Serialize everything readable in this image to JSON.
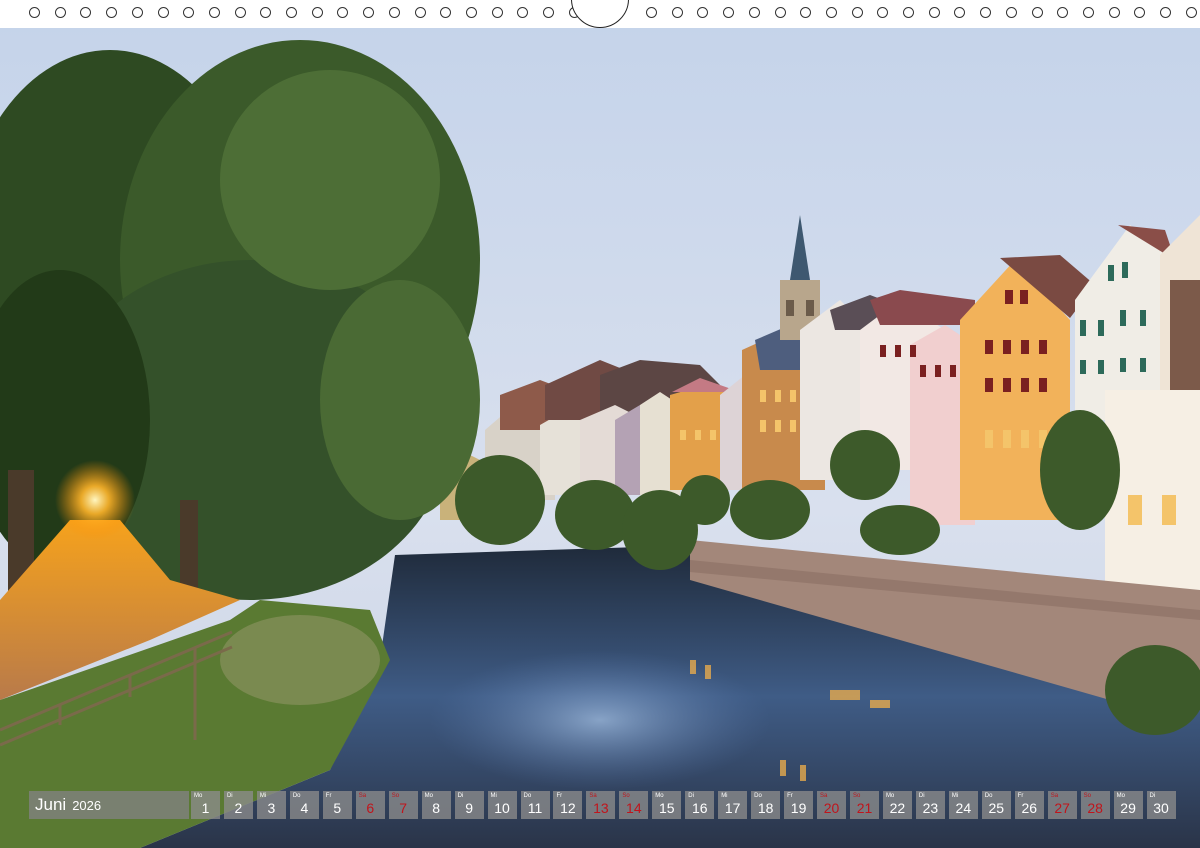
{
  "calendar": {
    "month": "Juni",
    "year": "2026",
    "days": [
      {
        "wd": "Mo",
        "d": "1",
        "we": false
      },
      {
        "wd": "Di",
        "d": "2",
        "we": false
      },
      {
        "wd": "Mi",
        "d": "3",
        "we": false
      },
      {
        "wd": "Do",
        "d": "4",
        "we": false
      },
      {
        "wd": "Fr",
        "d": "5",
        "we": false
      },
      {
        "wd": "Sa",
        "d": "6",
        "we": true
      },
      {
        "wd": "So",
        "d": "7",
        "we": true
      },
      {
        "wd": "Mo",
        "d": "8",
        "we": false
      },
      {
        "wd": "Di",
        "d": "9",
        "we": false
      },
      {
        "wd": "Mi",
        "d": "10",
        "we": false
      },
      {
        "wd": "Do",
        "d": "11",
        "we": false
      },
      {
        "wd": "Fr",
        "d": "12",
        "we": false
      },
      {
        "wd": "Sa",
        "d": "13",
        "we": true
      },
      {
        "wd": "So",
        "d": "14",
        "we": true
      },
      {
        "wd": "Mo",
        "d": "15",
        "we": false
      },
      {
        "wd": "Di",
        "d": "16",
        "we": false
      },
      {
        "wd": "Mi",
        "d": "17",
        "we": false
      },
      {
        "wd": "Do",
        "d": "18",
        "we": false
      },
      {
        "wd": "Fr",
        "d": "19",
        "we": false
      },
      {
        "wd": "Sa",
        "d": "20",
        "we": true
      },
      {
        "wd": "So",
        "d": "21",
        "we": true
      },
      {
        "wd": "Mo",
        "d": "22",
        "we": false
      },
      {
        "wd": "Di",
        "d": "23",
        "we": false
      },
      {
        "wd": "Mi",
        "d": "24",
        "we": false
      },
      {
        "wd": "Do",
        "d": "25",
        "we": false
      },
      {
        "wd": "Fr",
        "d": "26",
        "we": false
      },
      {
        "wd": "Sa",
        "d": "27",
        "we": true
      },
      {
        "wd": "So",
        "d": "28",
        "we": true
      },
      {
        "wd": "Mo",
        "d": "29",
        "we": false
      },
      {
        "wd": "Di",
        "d": "30",
        "we": false
      }
    ]
  },
  "colors": {
    "weekend": "#c0151c",
    "cell": "#8c8c8c",
    "sky_top": "#c9d6ea",
    "river": "#2c3a58"
  }
}
